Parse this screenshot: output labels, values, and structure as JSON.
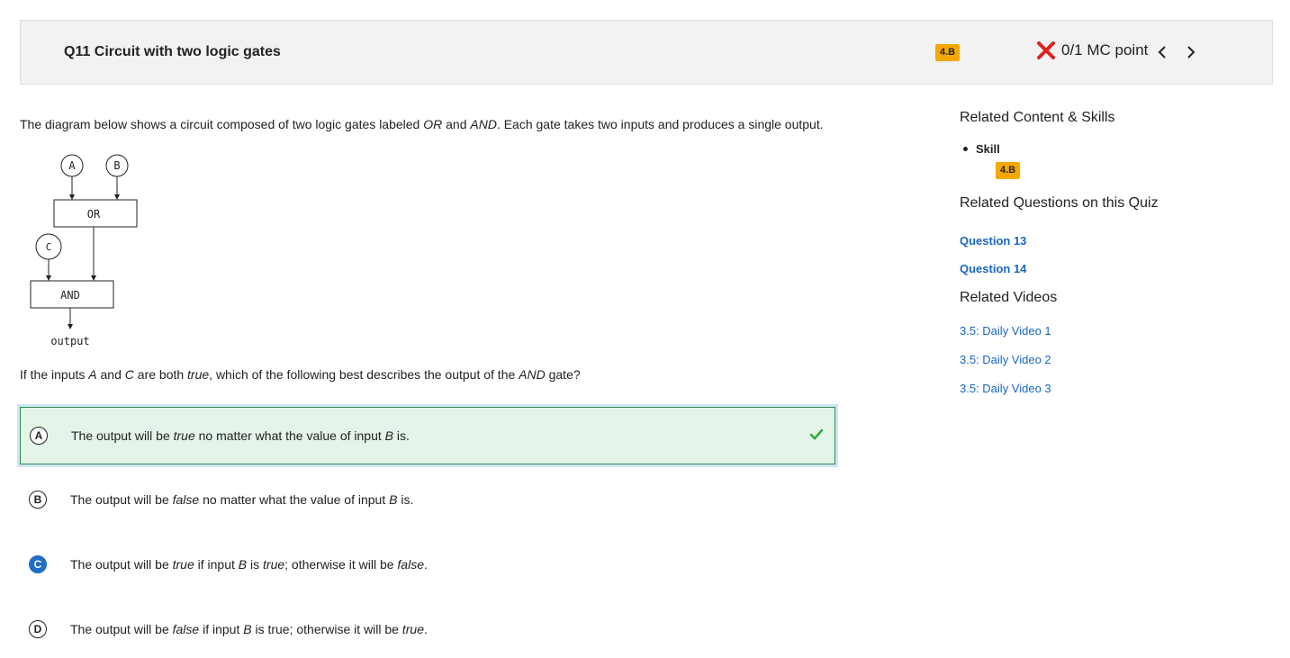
{
  "header": {
    "title": "Q11 Circuit with two logic gates",
    "skill_badge": "4.B",
    "score": "0/1 MC point"
  },
  "prompt": {
    "p1": "The diagram below shows a circuit composed of two logic gates labeled ",
    "or": "OR",
    "p2": " and ",
    "and": "AND",
    "p3": ". Each gate takes two inputs and produces a single output."
  },
  "diagram": {
    "input_a": "A",
    "input_b": "B",
    "input_c": "C",
    "gate_or": "OR",
    "gate_and": "AND",
    "output": "output"
  },
  "question": {
    "p1": "If the inputs ",
    "a": "A",
    "p2": " and ",
    "c": "C",
    "p3": " are both ",
    "true": "true",
    "p4": ", which of the following best describes the output of the ",
    "and": "AND",
    "p5": " gate?"
  },
  "choices": [
    {
      "letter": "A",
      "t1": "The output will be ",
      "e1": "true",
      "t2": " no matter what the value of input ",
      "e2": "B",
      "t3": " is."
    },
    {
      "letter": "B",
      "t1": "The output will be ",
      "e1": "false",
      "t2": " no matter what the value of input ",
      "e2": "B",
      "t3": " is."
    },
    {
      "letter": "C",
      "t1": "The output will be ",
      "e1": "true",
      "t2": " if input ",
      "e2": "B",
      "t3": " is ",
      "e3": "true",
      "t4": "; otherwise it will be ",
      "e4": "false",
      "t5": "."
    },
    {
      "letter": "D",
      "t1": "The output will be ",
      "e1": "false",
      "t2": " if input ",
      "e2": "B",
      "t3": " is true; otherwise it will be ",
      "e3": "true",
      "t4": "."
    }
  ],
  "sidebar": {
    "content_heading": "Related Content & Skills",
    "skill_label": "Skill",
    "skill_badge": "4.B",
    "questions_heading": "Related Questions on this Quiz",
    "questions": [
      "Question 13",
      "Question 14"
    ],
    "videos_heading": "Related Videos",
    "videos": [
      "3.5: Daily Video 1",
      "3.5: Daily Video 2",
      "3.5: Daily Video 3"
    ]
  },
  "colors": {
    "badge": "#f5a800",
    "correct_bg": "#e4f4e8",
    "selected": "#1f6fc7",
    "link": "#1a66c2",
    "wrong": "#e02020",
    "check": "#2eaa4a"
  }
}
